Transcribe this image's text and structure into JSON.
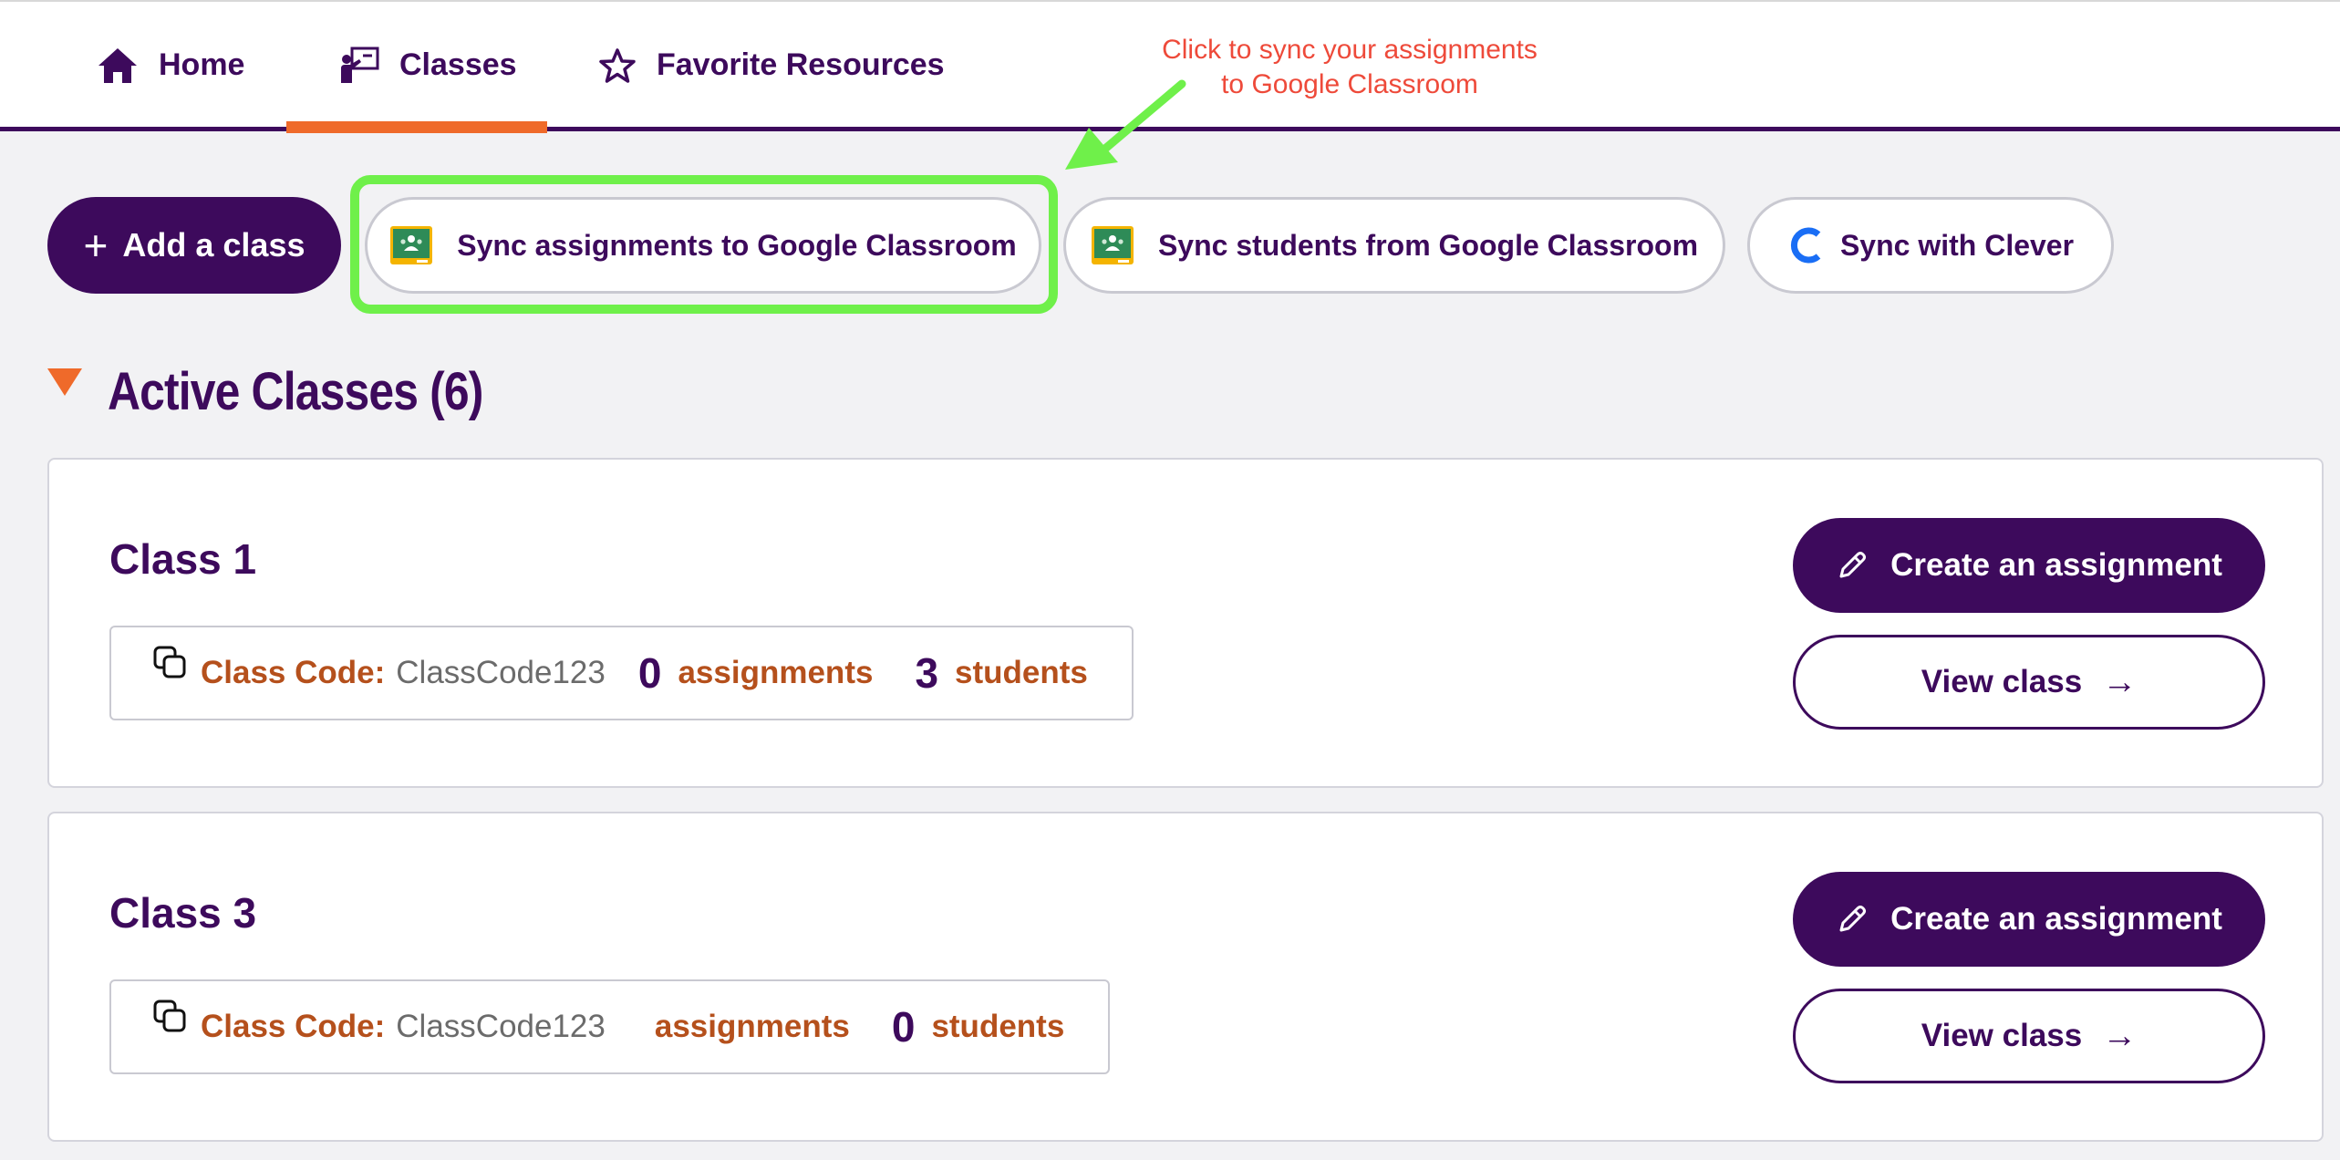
{
  "nav": {
    "items": [
      {
        "label": "Home",
        "icon": "house-icon"
      },
      {
        "label": "Classes",
        "icon": "teacher-board-icon",
        "active": true
      },
      {
        "label": "Favorite Resources",
        "icon": "star-outline-icon"
      }
    ]
  },
  "annotation": {
    "line1": "Click to sync your assignments",
    "line2": "to Google Classroom",
    "color": "#ee4a3a",
    "arrow_color": "#6ff04a"
  },
  "toolbar": {
    "add_class": "Add a class",
    "sync_assignments": "Sync assignments to Google Classroom",
    "sync_students": "Sync students from Google Classroom",
    "sync_clever": "Sync with Clever"
  },
  "section": {
    "title": "Active Classes (6)"
  },
  "classes": [
    {
      "name": "Class 1",
      "code_label": "Class Code:",
      "code": "ClassCode123",
      "assignments_count": "0",
      "assignments_label": "assignments",
      "students_count": "3",
      "students_label": "students",
      "create_label": "Create an assignment",
      "view_label": "View class"
    },
    {
      "name": "Class 3",
      "code_label": "Class Code:",
      "code": "ClassCode123",
      "assignments_count": "",
      "assignments_label": "assignments",
      "students_count": "0",
      "students_label": "students",
      "create_label": "Create an assignment",
      "view_label": "View class"
    }
  ],
  "colors": {
    "brand_purple": "#3d0a5c",
    "accent_orange": "#ef6a2a",
    "label_orange": "#b5501c",
    "highlight_green": "#6ff04a"
  }
}
